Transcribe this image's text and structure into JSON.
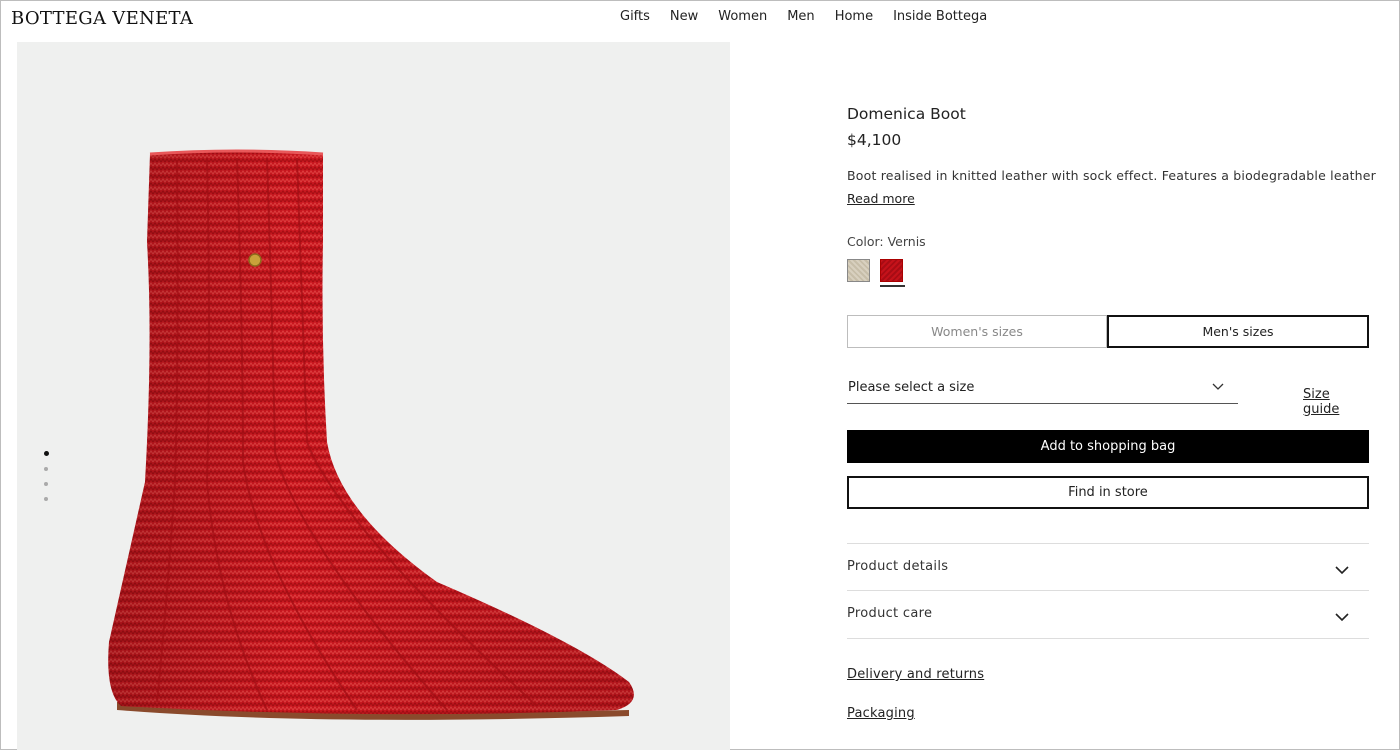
{
  "header": {
    "logo": "BOTTEGA VENETA",
    "nav": [
      "Gifts",
      "New",
      "Women",
      "Men",
      "Home",
      "Inside Bottega"
    ]
  },
  "gallery": {
    "image_alt": "Red knitted leather sock boot",
    "dot_count": 4,
    "active_dot": 1
  },
  "product": {
    "name": "Domenica Boot",
    "price": "$4,100",
    "description": "Boot realised in knitted leather with sock effect. Features a biodegradable leather",
    "read_more": "Read more",
    "color_label": "Color: Vernis",
    "swatches": [
      {
        "name": "beige-swatch",
        "color": "#d4cbb8",
        "selected": false
      },
      {
        "name": "red-swatch",
        "color": "#c0121b",
        "selected": true
      }
    ],
    "size_tabs": {
      "women": "Women's sizes",
      "men": "Men's sizes",
      "active": "men"
    },
    "size_select": {
      "placeholder": "Please select a size"
    },
    "size_guide": "Size guide",
    "add_to_bag": "Add to shopping bag",
    "find_in_store": "Find in store",
    "accordions": [
      "Product details",
      "Product care"
    ],
    "links": [
      "Delivery and returns",
      "Packaging"
    ]
  },
  "colors": {
    "boot_red": "#c8161e",
    "button_black": "#000000",
    "gallery_bg": "#eff0ef"
  }
}
